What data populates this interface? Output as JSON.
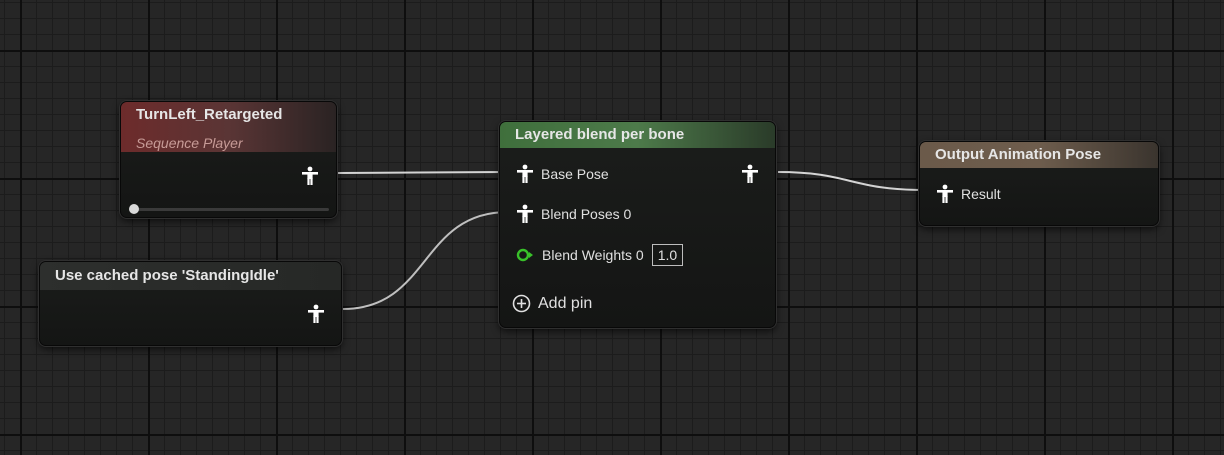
{
  "nodes": {
    "sequence_player": {
      "title": "TurnLeft_Retargeted",
      "subtitle": "Sequence Player",
      "playback_position": 0.0
    },
    "cached_pose": {
      "title": "Use cached pose 'StandingIdle'"
    },
    "layered_blend": {
      "title": "Layered blend per bone",
      "pins": {
        "base_pose": "Base Pose",
        "blend_poses": "Blend Poses 0",
        "blend_weights": "Blend Weights 0",
        "blend_weights_value": "1.0",
        "add_pin": "Add pin"
      }
    },
    "output_pose": {
      "title": "Output Animation Pose",
      "pins": {
        "result": "Result"
      }
    }
  },
  "colors": {
    "header_sequence_player": "#6d2b2b",
    "header_layered_blend": "#4d7a4a",
    "header_output_pose": "#6e5d4d",
    "wire": "#d4d4d4",
    "float_pin": "#39c12a",
    "pose_pin": "#ffffff"
  },
  "icons": {
    "pose_pin": "pose-figure-icon",
    "float_pin": "float-pin-icon",
    "add_pin": "plus-circle-icon"
  }
}
